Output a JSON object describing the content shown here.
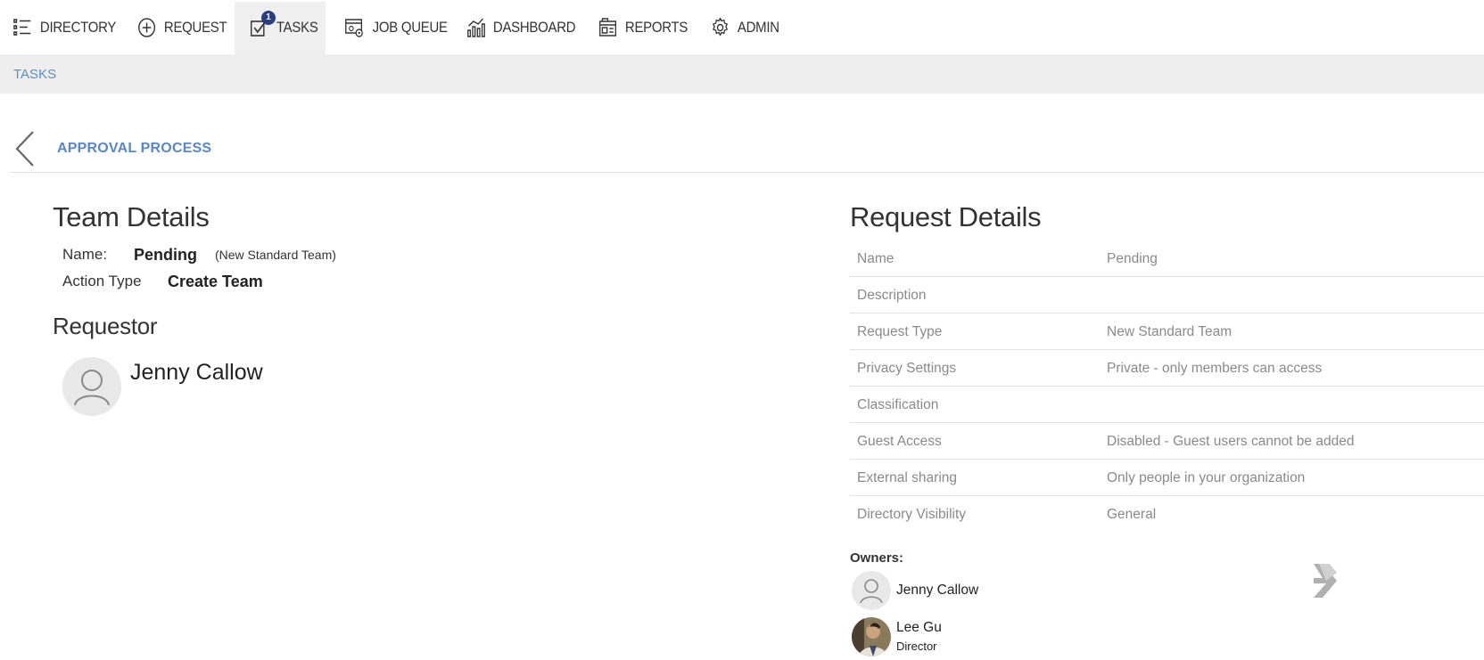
{
  "nav": {
    "items": [
      {
        "label": "DIRECTORY",
        "icon": "list-icon"
      },
      {
        "label": "REQUEST",
        "icon": "plus-circle-icon"
      },
      {
        "label": "TASKS",
        "icon": "checkbox-icon",
        "badge": "1"
      },
      {
        "label": "JOB QUEUE",
        "icon": "job-queue-icon"
      },
      {
        "label": "DASHBOARD",
        "icon": "chart-icon"
      },
      {
        "label": "REPORTS",
        "icon": "reports-icon"
      },
      {
        "label": "ADMIN",
        "icon": "gear-icon"
      }
    ]
  },
  "breadcrumb": "TASKS",
  "page_title": "APPROVAL PROCESS",
  "team_details": {
    "heading": "Team Details",
    "name_label": "Name:",
    "name_value": "Pending",
    "name_type": "(New Standard Team)",
    "action_label": "Action Type",
    "action_value": "Create Team"
  },
  "requestor": {
    "heading": "Requestor",
    "name": "Jenny Callow"
  },
  "request_details": {
    "heading": "Request Details",
    "rows": [
      {
        "label": "Name",
        "value": "Pending"
      },
      {
        "label": "Description",
        "value": ""
      },
      {
        "label": "Request Type",
        "value": "New Standard Team"
      },
      {
        "label": "Privacy Settings",
        "value": "Private - only members can access"
      },
      {
        "label": "Classification",
        "value": ""
      },
      {
        "label": "Guest Access",
        "value": "Disabled - Guest users cannot be added"
      },
      {
        "label": "External sharing",
        "value": "Only people in your organization"
      },
      {
        "label": "Directory Visibility",
        "value": "General"
      }
    ]
  },
  "owners": {
    "label": "Owners:",
    "list": [
      {
        "name": "Jenny Callow",
        "role": ""
      },
      {
        "name": "Lee Gu",
        "role": "Director"
      }
    ]
  },
  "colors": {
    "accent": "#5a87c6",
    "badge": "#2a3d7c",
    "subbar": "#eeeeee"
  }
}
